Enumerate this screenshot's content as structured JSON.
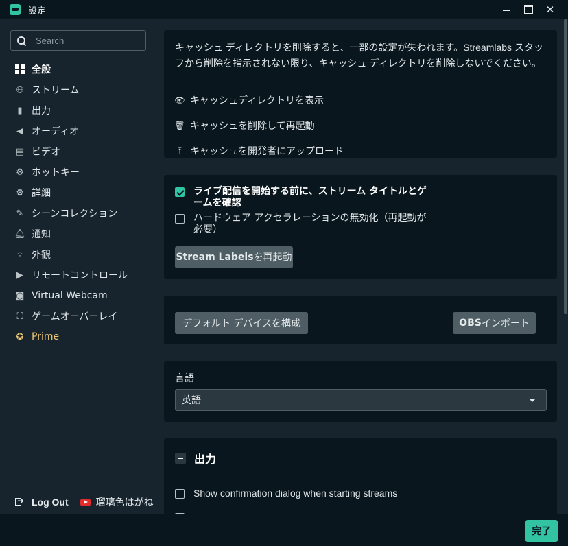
{
  "window": {
    "title": "設定"
  },
  "search": {
    "placeholder": "Search"
  },
  "sidebar": {
    "items": [
      {
        "label": "全般",
        "icon": "grid-icon"
      },
      {
        "label": "ストリーム",
        "icon": "globe-icon"
      },
      {
        "label": "出力",
        "icon": "output-icon"
      },
      {
        "label": "オーディオ",
        "icon": "speaker-icon"
      },
      {
        "label": "ビデオ",
        "icon": "film-icon"
      },
      {
        "label": "ホットキー",
        "icon": "gear-icon"
      },
      {
        "label": "詳細",
        "icon": "gears-icon"
      },
      {
        "label": "シーンコレクション",
        "icon": "collection-icon"
      },
      {
        "label": "通知",
        "icon": "bell-icon"
      },
      {
        "label": "外観",
        "icon": "appearance-icon"
      },
      {
        "label": "リモートコントロール",
        "icon": "play-circle-icon"
      },
      {
        "label": "Virtual Webcam",
        "icon": "camera-icon"
      },
      {
        "label": "ゲームオーバーレイ",
        "icon": "expand-icon"
      },
      {
        "label": "Prime",
        "icon": "prime-star-icon"
      }
    ],
    "active_index": 0,
    "logout_label": "Log Out",
    "account_name": "瑠璃色はがね"
  },
  "cache": {
    "description": "キャッシュ ディレクトリを削除すると、一部の設定が失われます。Streamlabs スタッフから削除を指示されない限り、キャッシュ ディレクトリを削除しないでください。",
    "show_dir": "キャッシュディレクトリを表示",
    "delete_restart": "キャッシュを削除して再起動",
    "upload": "キャッシュを開発者にアップロード"
  },
  "stream_options": {
    "confirm_title": "ライブ配信を開始する前に、ストリーム タイトルとゲームを確認",
    "confirm_title_checked": true,
    "disable_hw_accel": "ハードウェア アクセラレーションの無効化（再起動が必要）",
    "disable_hw_accel_checked": false,
    "restart_labels_prefix": "Stream Labels",
    "restart_labels_suffix": " を再起動"
  },
  "devices": {
    "configure_default": "デフォルト デバイスを構成",
    "obs_import_prefix": "OBS",
    "obs_import_suffix": " インポート"
  },
  "language": {
    "label": "言語",
    "value": "英語"
  },
  "output_section": {
    "title": "出力",
    "confirm_start_dialog": "Show confirmation dialog when starting streams",
    "confirm_start_checked": false
  },
  "footer": {
    "done_label": "完了"
  },
  "colors": {
    "accent": "#31c3a2",
    "prime": "#f0c674",
    "card_bg": "#09161d",
    "page_bg": "#17242d"
  }
}
